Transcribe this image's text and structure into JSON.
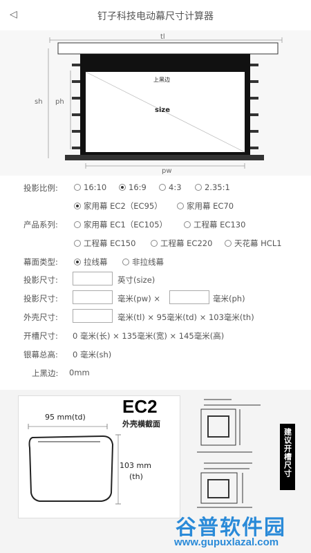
{
  "header": {
    "back_icon": "back-arrow-icon",
    "title": "钉子科技电动幕尺寸计算器"
  },
  "diagram": {
    "labels": {
      "tl": "tl",
      "sh": "sh",
      "ph": "ph",
      "pw": "pw",
      "top_black": "上黑边",
      "size": "size"
    }
  },
  "aspect": {
    "label": "投影比例:",
    "options": [
      "16:10",
      "16:9",
      "4:3",
      "2.35:1"
    ],
    "selected": "16:9"
  },
  "home": {
    "options": [
      "家用幕 EC2（EC95）",
      "家用幕 EC70"
    ],
    "selected": "家用幕 EC2（EC95）"
  },
  "series": {
    "label": "产品系列:",
    "options": [
      "家用幕 EC1（EC105）",
      "工程幕 EC130",
      "工程幕 EC150",
      "工程幕 EC220",
      "天花幕 HCL1"
    ]
  },
  "screen_type": {
    "label": "幕面类型:",
    "options": [
      "拉线幕",
      "非拉线幕"
    ],
    "selected": "拉线幕"
  },
  "size_row": {
    "label": "投影尺寸:",
    "value": "",
    "unit": "英寸(size)"
  },
  "dims_row": {
    "label": "投影尺寸:",
    "pw_value": "",
    "pw_unit": "毫米(pw)  ×",
    "ph_value": "",
    "ph_unit": "毫米(ph)"
  },
  "shell_row": {
    "label": "外壳尺寸:",
    "value": "",
    "text": "毫米(tl)  ×  95毫米(td)  ×  103毫米(th)"
  },
  "slot_row": {
    "label": "开槽尺寸:",
    "text": "0  毫米(长)  ×  135毫米(宽)  ×  145毫米(高)"
  },
  "total_row": {
    "label": "银幕总高:",
    "text": "0  毫米(sh)"
  },
  "black_row": {
    "label": "上黑边:",
    "text": "0mm"
  },
  "cross_section": {
    "model": "EC2",
    "subtitle": "外壳横截面",
    "td": "95 mm(td)",
    "th_value": "103 mm",
    "th_unit": "(th)"
  },
  "side_button": {
    "label": "建议开槽尺寸"
  },
  "watermark": {
    "big": "谷普软件园",
    "small": "www.gupuxlazal.com"
  }
}
